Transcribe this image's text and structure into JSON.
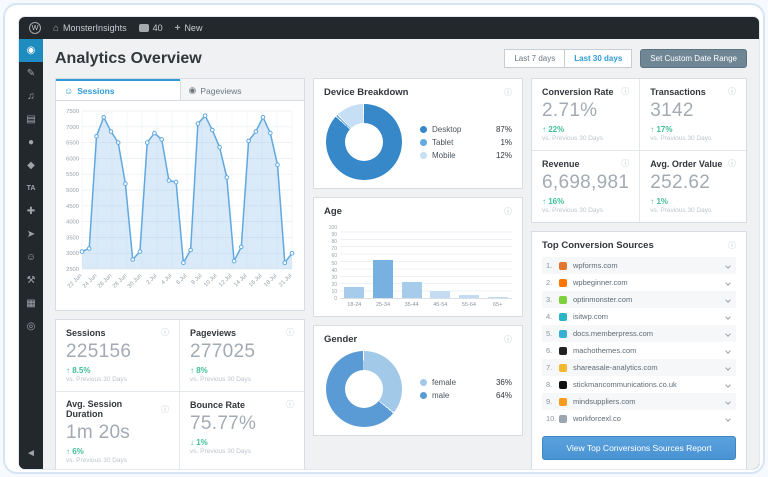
{
  "colors": {
    "accent_blue": "#2e9bd6",
    "positive_green": "#3fbf97",
    "line_blue": "#5fa8e0",
    "button_blue": "#4a93d3",
    "admin_dark": "#23282d",
    "active_sidebar": "#1e8cbe"
  },
  "admin_bar": {
    "wp_logo": "W",
    "site_name": "MonsterInsights",
    "comments_count": "40",
    "new_label": "New"
  },
  "sidebar": {
    "items": [
      {
        "name": "monsterinsights",
        "glyph": "◉",
        "active": true
      },
      {
        "name": "posts",
        "glyph": "✎"
      },
      {
        "name": "media",
        "glyph": "♫"
      },
      {
        "name": "pages",
        "glyph": "▤"
      },
      {
        "name": "comments",
        "glyph": "●"
      },
      {
        "name": "downloads",
        "glyph": "◆"
      },
      {
        "name": "ta-plugin",
        "glyph": "TA",
        "text": true
      },
      {
        "name": "plugins",
        "glyph": "✚"
      },
      {
        "name": "seedprod",
        "glyph": "➤"
      },
      {
        "name": "users",
        "glyph": "☺"
      },
      {
        "name": "tools",
        "glyph": "⚒"
      },
      {
        "name": "settings",
        "glyph": "▦"
      },
      {
        "name": "awards",
        "glyph": "◎"
      },
      {
        "name": "collapse-menu",
        "glyph": "◄",
        "pinned": true
      }
    ]
  },
  "header": {
    "title": "Analytics Overview",
    "range_buttons": [
      {
        "label": "Last 7 days",
        "active": false
      },
      {
        "label": "Last 30 days",
        "active": true
      }
    ],
    "custom_range_label": "Set Custom Date Range"
  },
  "tabs": {
    "sessions": "Sessions",
    "pageviews": "Pageviews"
  },
  "chart_data": [
    {
      "id": "sessions_over_time",
      "type": "line",
      "title": "Sessions",
      "x": [
        "22 Jun",
        "23 Jun",
        "24 Jun",
        "25 Jun",
        "26 Jun",
        "27 Jun",
        "28 Jun",
        "29 Jun",
        "30 Jun",
        "1 Jul",
        "2 Jul",
        "3 Jul",
        "4 Jul",
        "5 Jul",
        "6 Jul",
        "7 Jul",
        "8 Jul",
        "9 Jul",
        "10 Jul",
        "11 Jul",
        "12 Jul",
        "13 Jul",
        "14 Jul",
        "15 Jul",
        "16 Jul",
        "17 Jul",
        "18 Jul",
        "19 Jul",
        "20 Jul",
        "21 Jul"
      ],
      "values": [
        3050,
        3150,
        6700,
        7300,
        6850,
        6500,
        5200,
        2800,
        3050,
        6500,
        6800,
        6600,
        5300,
        5250,
        2700,
        3100,
        7100,
        7350,
        6900,
        6350,
        5400,
        2750,
        3200,
        6550,
        6850,
        7300,
        6800,
        5800,
        2700,
        3000
      ],
      "x_tick_labels": [
        "22 Jun",
        "24 Jun",
        "26 Jun",
        "28 Jun",
        "30 Jun",
        "2 Jul",
        "4 Jul",
        "6 Jul",
        "8 Jul",
        "10 Jul",
        "12 Jul",
        "14 Jul",
        "16 Jul",
        "18 Jul",
        "21 Jul"
      ],
      "ylim": [
        2500,
        7500
      ],
      "ytick_step": 500,
      "grid": true,
      "line_color": "#5fa8e0",
      "fill_color": "rgba(150,195,235,0.35)"
    },
    {
      "id": "device_breakdown",
      "type": "pie",
      "title": "Device Breakdown",
      "labels": [
        "Desktop",
        "Tablet",
        "Mobile"
      ],
      "values": [
        87,
        1,
        12
      ],
      "display": [
        "87%",
        "1%",
        "12%"
      ],
      "colors": [
        "#3688c9",
        "#61a9e0",
        "#c7dff4"
      ],
      "legend_position": "right"
    },
    {
      "id": "age",
      "type": "bar",
      "title": "Age",
      "categories": [
        "18-24",
        "25-34",
        "35-44",
        "45-54",
        "55-64",
        "65+"
      ],
      "values": [
        15,
        51,
        22,
        10,
        4,
        1
      ],
      "colors": [
        "#a7cbea",
        "#78b1e0",
        "#a7cbea",
        "#c3dcf2",
        "#c3dcf2",
        "#c3dcf2"
      ],
      "ylim": [
        0,
        100
      ],
      "ytick_step": 10,
      "grid": true
    },
    {
      "id": "gender",
      "type": "pie",
      "title": "Gender",
      "labels": [
        "female",
        "male"
      ],
      "values": [
        36,
        64
      ],
      "display": [
        "36%",
        "64%"
      ],
      "colors": [
        "#a3c9e9",
        "#5b9bd5"
      ],
      "legend_position": "right"
    }
  ],
  "stats_left": [
    {
      "label": "Sessions",
      "value": "225156",
      "change": "8.5%",
      "dir": "up",
      "vs": "vs. Previous 30 Days"
    },
    {
      "label": "Pageviews",
      "value": "277025",
      "change": "8%",
      "dir": "up",
      "vs": "vs. Previous 30 Days"
    },
    {
      "label": "Avg. Session Duration",
      "value": "1m 20s",
      "change": "6%",
      "dir": "up",
      "vs": "vs. Previous 30 Days"
    },
    {
      "label": "Bounce Rate",
      "value": "75.77%",
      "change": "1%",
      "dir": "down",
      "vs": "vs. Previous 30 Days"
    }
  ],
  "stats_right": [
    {
      "label": "Conversion Rate",
      "value": "2.71%",
      "change": "22%",
      "dir": "up",
      "vs": "vs. Previous 30 Days"
    },
    {
      "label": "Transactions",
      "value": "3142",
      "change": "17%",
      "dir": "up",
      "vs": "vs. Previous 30 Days"
    },
    {
      "label": "Revenue",
      "value": "6,698,981",
      "change": "16%",
      "dir": "up",
      "vs": "vs. Previous 30 Days"
    },
    {
      "label": "Avg. Order Value",
      "value": "252.62",
      "change": "1%",
      "dir": "up",
      "vs": "vs. Previous 30 Days"
    }
  ],
  "top_sources": {
    "title": "Top Conversion Sources",
    "items": [
      {
        "rank": "1.",
        "domain": "wpforms.com",
        "favicon_color": "#e27730"
      },
      {
        "rank": "2.",
        "domain": "wpbeginner.com",
        "favicon_color": "#ff7700"
      },
      {
        "rank": "3.",
        "domain": "optinmonster.com",
        "favicon_color": "#7fd03f"
      },
      {
        "rank": "4.",
        "domain": "isitwp.com",
        "favicon_color": "#2cb4c7"
      },
      {
        "rank": "5.",
        "domain": "docs.memberpress.com",
        "favicon_color": "#36b0d3"
      },
      {
        "rank": "6.",
        "domain": "machothemes.com",
        "favicon_color": "#222222"
      },
      {
        "rank": "7.",
        "domain": "shareasale-analytics.com",
        "favicon_color": "#f4b731"
      },
      {
        "rank": "8.",
        "domain": "stickmancommunications.co.uk",
        "favicon_color": "#111111"
      },
      {
        "rank": "9.",
        "domain": "mindsuppliers.com",
        "favicon_color": "#f59b1e"
      },
      {
        "rank": "10.",
        "domain": "workforcexl.co",
        "favicon_color": "#9aa7b0"
      }
    ],
    "button_label": "View Top Conversions Sources Report"
  }
}
